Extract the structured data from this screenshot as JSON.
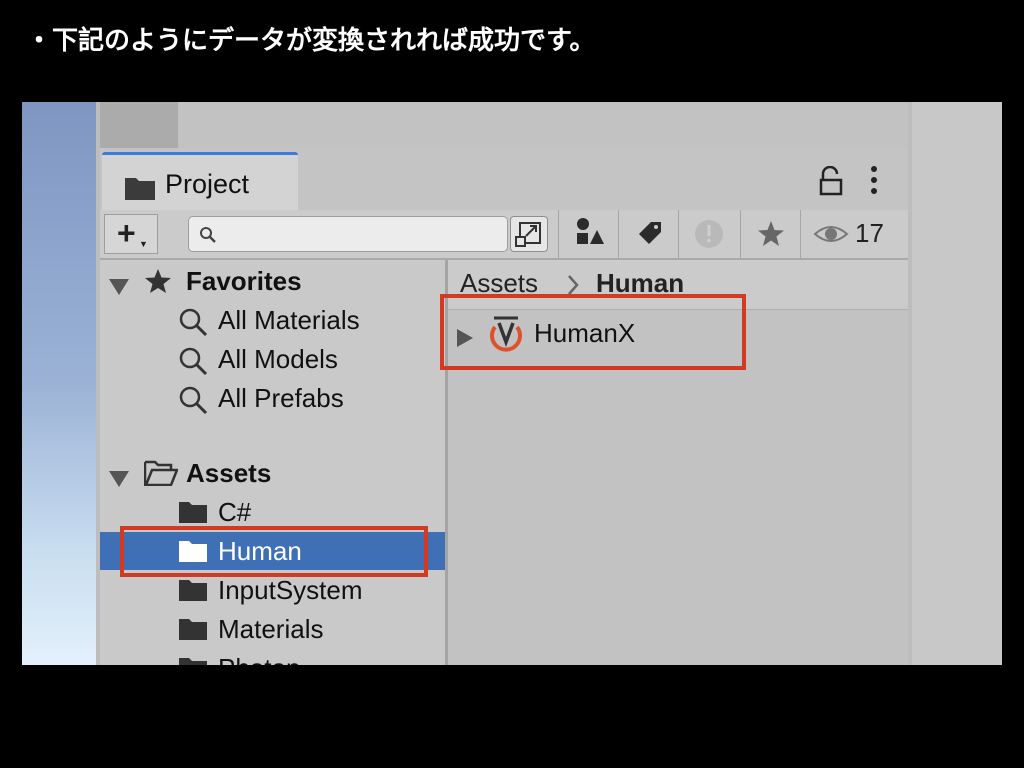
{
  "slide": {
    "title": "・下記のようにデータが変換されれば成功です。"
  },
  "window": {
    "tab_label": "Project"
  },
  "toolbar": {
    "add_plus": "+",
    "search": {
      "value": "",
      "placeholder": ""
    },
    "hidden_count": "17"
  },
  "sidebar": {
    "favorites": {
      "label": "Favorites",
      "items": [
        "All Materials",
        "All Models",
        "All Prefabs"
      ]
    },
    "assets": {
      "label": "Assets",
      "items": [
        {
          "label": "C#",
          "selected": false
        },
        {
          "label": "Human",
          "selected": true
        },
        {
          "label": "InputSystem",
          "selected": false
        },
        {
          "label": "Materials",
          "selected": false
        },
        {
          "label": "Photon",
          "selected": false
        }
      ]
    }
  },
  "main": {
    "breadcrumb": [
      "Assets",
      "Human"
    ],
    "items": [
      {
        "label": "HumanX",
        "icon": "vrm-model-icon"
      }
    ]
  },
  "colors": {
    "selection": "#3f6fb5",
    "highlight": "#d33a22",
    "tab_accent": "#3e7ad6",
    "vrm_icon": "#e0502a"
  }
}
